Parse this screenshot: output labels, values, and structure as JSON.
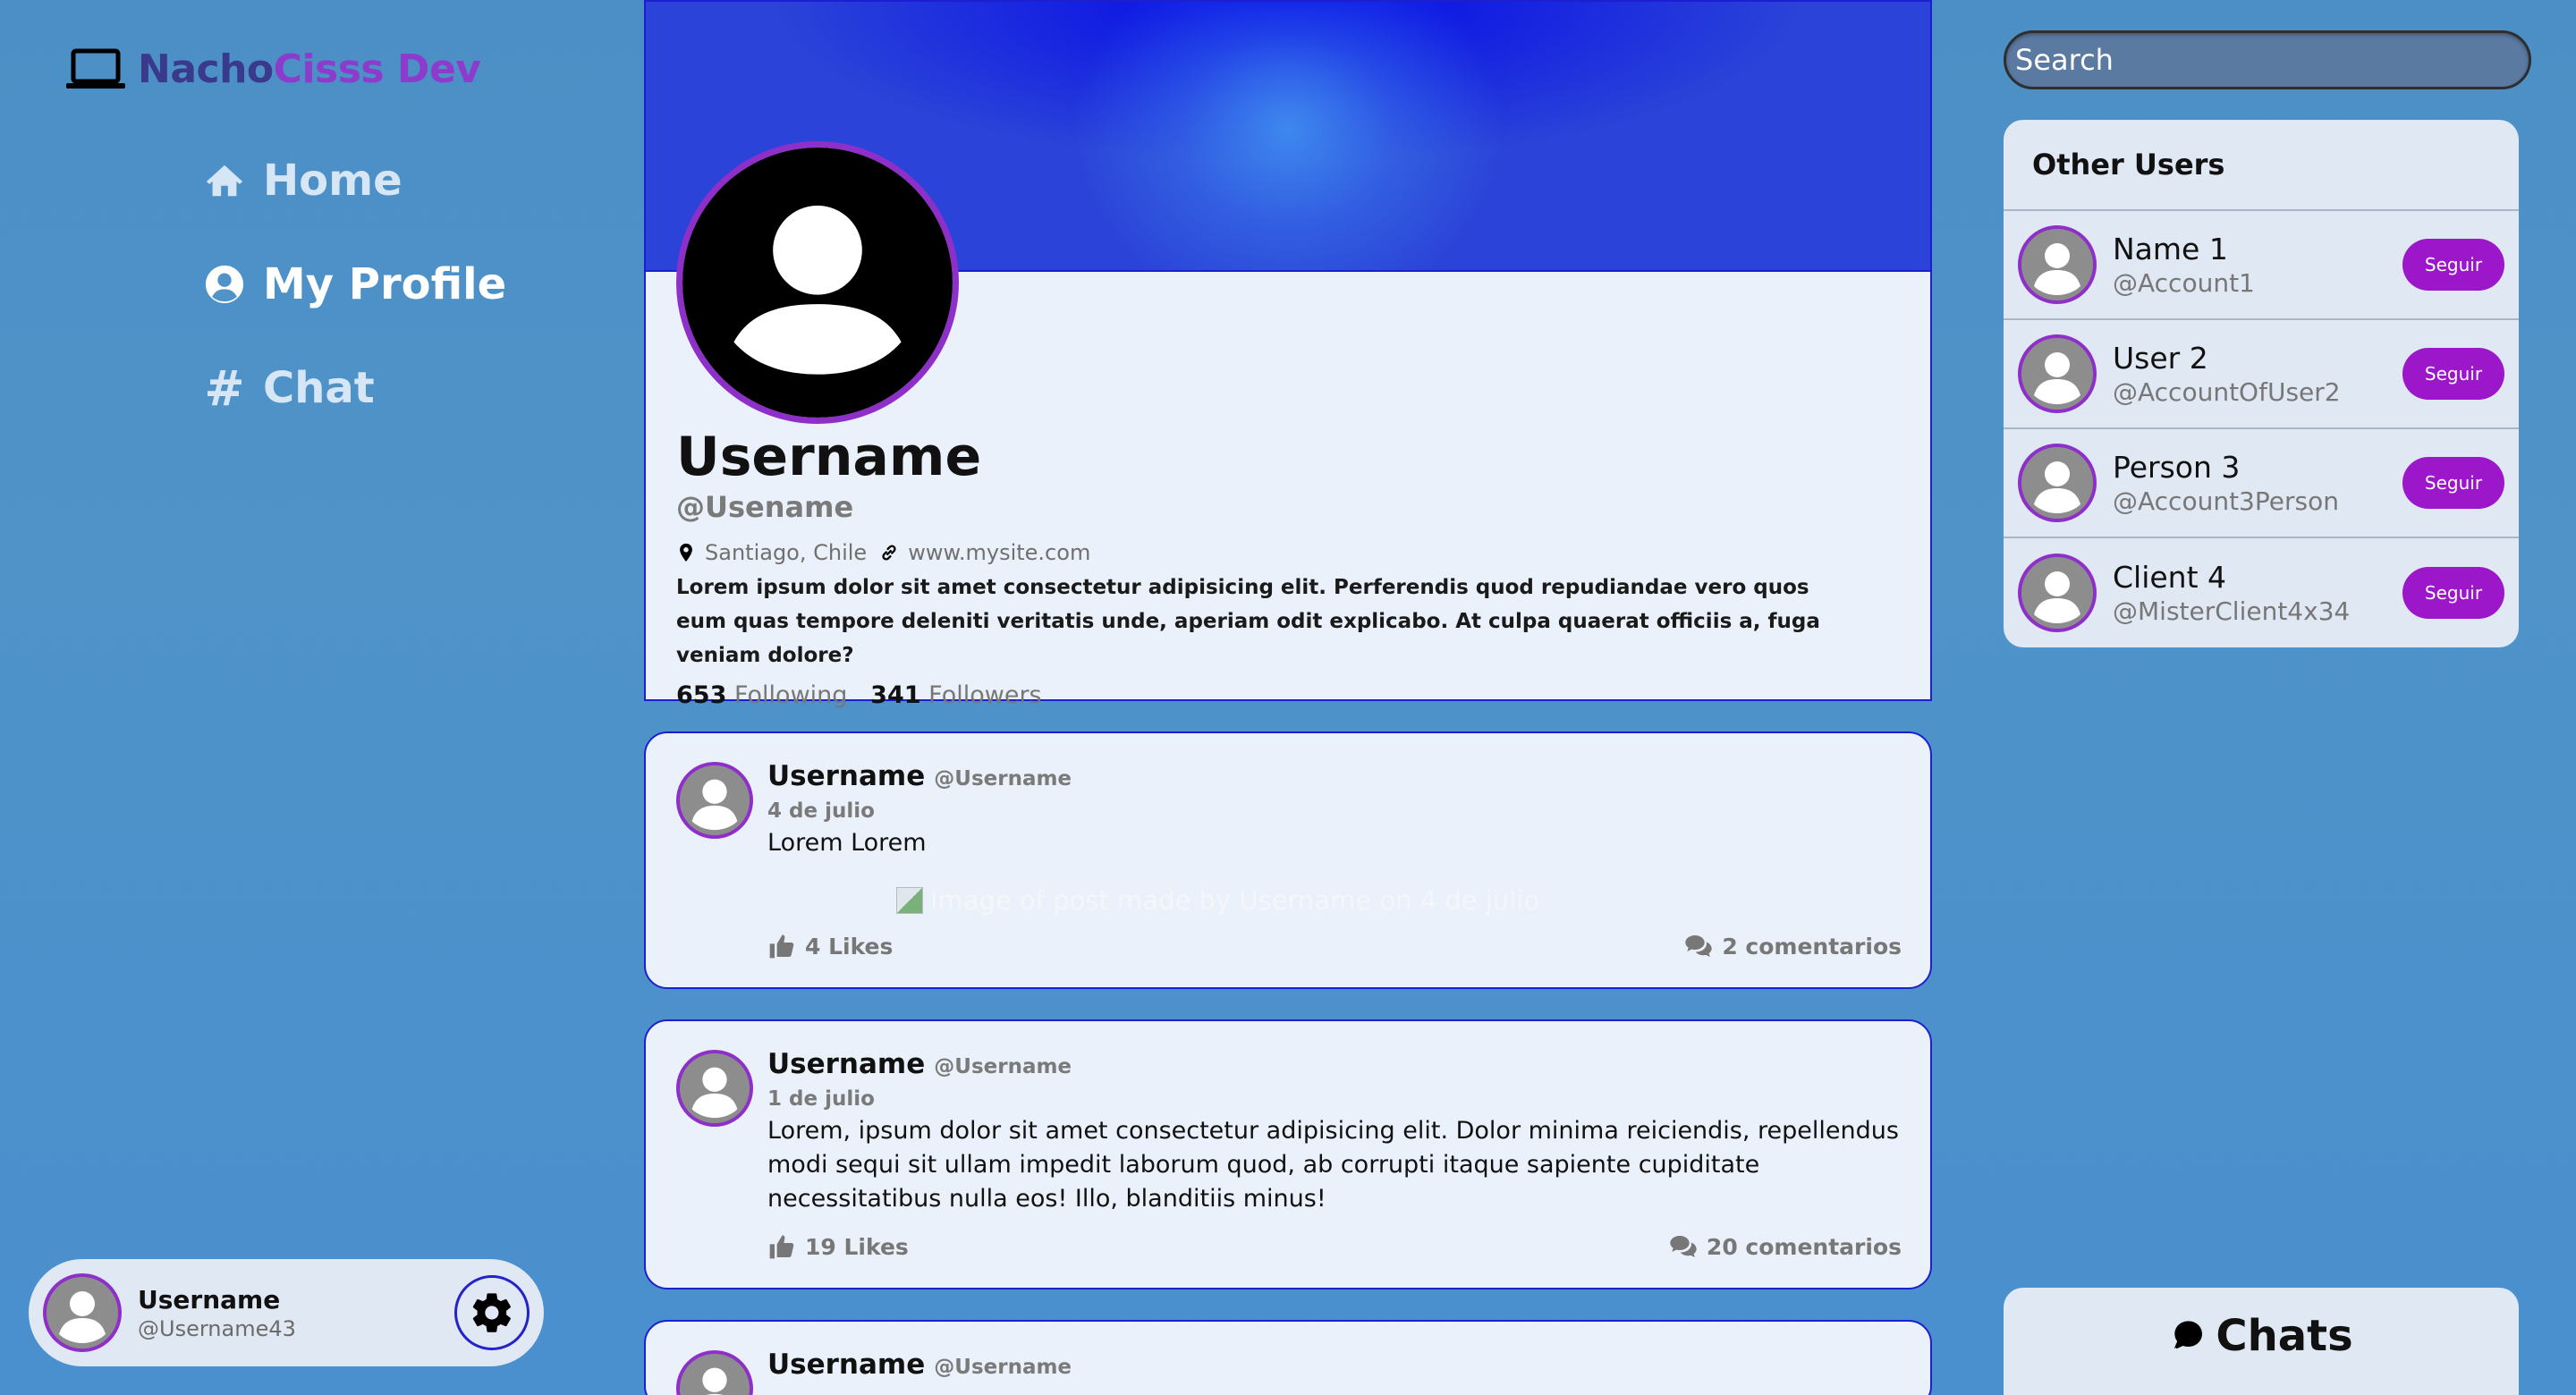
{
  "brand": {
    "part1": "Nacho",
    "part2": "Cisss Dev",
    "icon": "laptop-icon"
  },
  "nav": [
    {
      "label": "Home",
      "icon": "home-icon"
    },
    {
      "label": "My Profile",
      "icon": "user-circle-icon"
    },
    {
      "label": "Chat",
      "icon": "hashtag-icon",
      "glyph": "#"
    }
  ],
  "current_user": {
    "name": "Username",
    "handle": "@Username43"
  },
  "profile": {
    "name": "Username",
    "handle": "@Usename",
    "location": "Santiago, Chile",
    "website": "www.mysite.com",
    "bio": "Lorem ipsum dolor sit amet consectetur adipisicing elit. Perferendis quod repudiandae vero quos eum quas tempore deleniti veritatis unde, aperiam odit explicabo. At culpa quaerat officiis a, fuga veniam dolore?",
    "following_count": "653",
    "following_label": "Following",
    "followers_count": "341",
    "followers_label": "Followers"
  },
  "posts": [
    {
      "name": "Username",
      "handle": "@Username",
      "date": "4 de julio",
      "text": "Lorem Lorem",
      "image_alt": "Image of post made by Username on 4 de julio",
      "likes": "4 Likes",
      "comments": "2 comentarios"
    },
    {
      "name": "Username",
      "handle": "@Username",
      "date": "1 de julio",
      "text": "Lorem, ipsum dolor sit amet consectetur adipisicing elit. Dolor minima reiciendis, repellendus modi sequi sit ullam impedit laborum quod, ab corrupti itaque sapiente cupiditate necessitatibus nulla eos! Illo, blanditiis minus!",
      "likes": "19 Likes",
      "comments": "20 comentarios"
    },
    {
      "name": "Username",
      "handle": "@Username"
    }
  ],
  "search": {
    "placeholder": "Search"
  },
  "other_users": {
    "title": "Other Users",
    "follow_label": "Seguir",
    "items": [
      {
        "name": "Name 1",
        "handle": "@Account1"
      },
      {
        "name": "User 2",
        "handle": "@AccountOfUser2"
      },
      {
        "name": "Person 3",
        "handle": "@Account3Person"
      },
      {
        "name": "Client 4",
        "handle": "@MisterClient4x34"
      }
    ]
  },
  "chats": {
    "label": "Chats",
    "icon": "chat-bubble-icon"
  },
  "colors": {
    "accent": "#9b17c9",
    "border_blue": "#1b1fd0",
    "banner": "#2b43d8",
    "card_bg": "#eaf1fa"
  }
}
